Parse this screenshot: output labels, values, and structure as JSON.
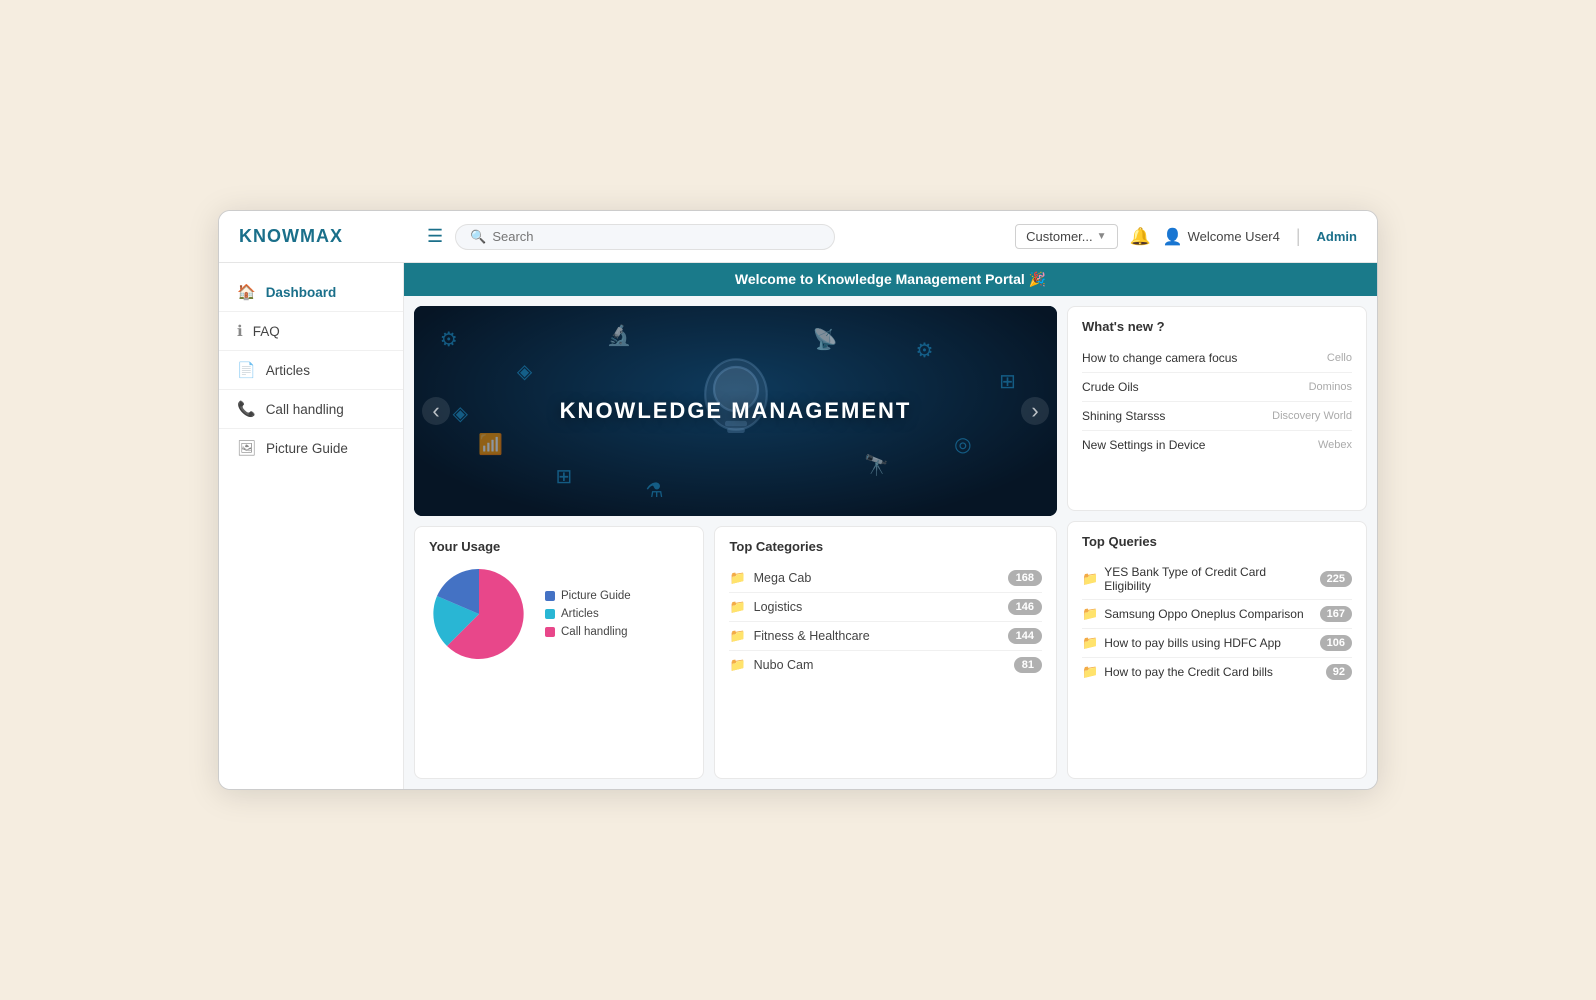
{
  "header": {
    "logo": "KNOWMAX",
    "search_placeholder": "Search",
    "customer_dropdown": "Customer...",
    "welcome_text": "Welcome  User4",
    "admin_label": "Admin"
  },
  "welcome_banner": "Welcome to Knowledge Management Portal 🎉",
  "sidebar": {
    "items": [
      {
        "id": "dashboard",
        "label": "Dashboard",
        "icon": "🏠"
      },
      {
        "id": "faq",
        "label": "FAQ",
        "icon": "ℹ️"
      },
      {
        "id": "articles",
        "label": "Articles",
        "icon": "📄"
      },
      {
        "id": "call-handling",
        "label": "Call handling",
        "icon": "📞"
      },
      {
        "id": "picture-guide",
        "label": "Picture Guide",
        "icon": "🖼"
      }
    ]
  },
  "hero": {
    "title": "KNOWLEDGE MANAGEMENT"
  },
  "usage": {
    "title": "Your Usage",
    "legend": [
      {
        "label": "Picture Guide",
        "color": "#4472c4"
      },
      {
        "label": "Articles",
        "color": "#29b6d4"
      },
      {
        "label": "Call handling",
        "color": "#e8478a"
      }
    ]
  },
  "top_categories": {
    "title": "Top Categories",
    "items": [
      {
        "name": "Mega Cab",
        "count": "168"
      },
      {
        "name": "Logistics",
        "count": "146"
      },
      {
        "name": "Fitness & Healthcare",
        "count": "144"
      },
      {
        "name": "Nubo Cam",
        "count": "81"
      }
    ]
  },
  "whats_new": {
    "title": "What's new ?",
    "items": [
      {
        "title": "How to change camera focus",
        "source": "Cello"
      },
      {
        "title": "Crude Oils",
        "source": "Dominos"
      },
      {
        "title": "Shining Starsss",
        "source": "Discovery World"
      },
      {
        "title": "New Settings in Device",
        "source": "Webex"
      }
    ]
  },
  "top_queries": {
    "title": "Top Queries",
    "items": [
      {
        "text": "YES Bank Type of Credit Card Eligibility",
        "count": "225"
      },
      {
        "text": "Samsung Oppo Oneplus Comparison",
        "count": "167"
      },
      {
        "text": "How to pay bills using HDFC App",
        "count": "106"
      },
      {
        "text": "How to pay the Credit Card bills",
        "count": "92"
      }
    ]
  }
}
